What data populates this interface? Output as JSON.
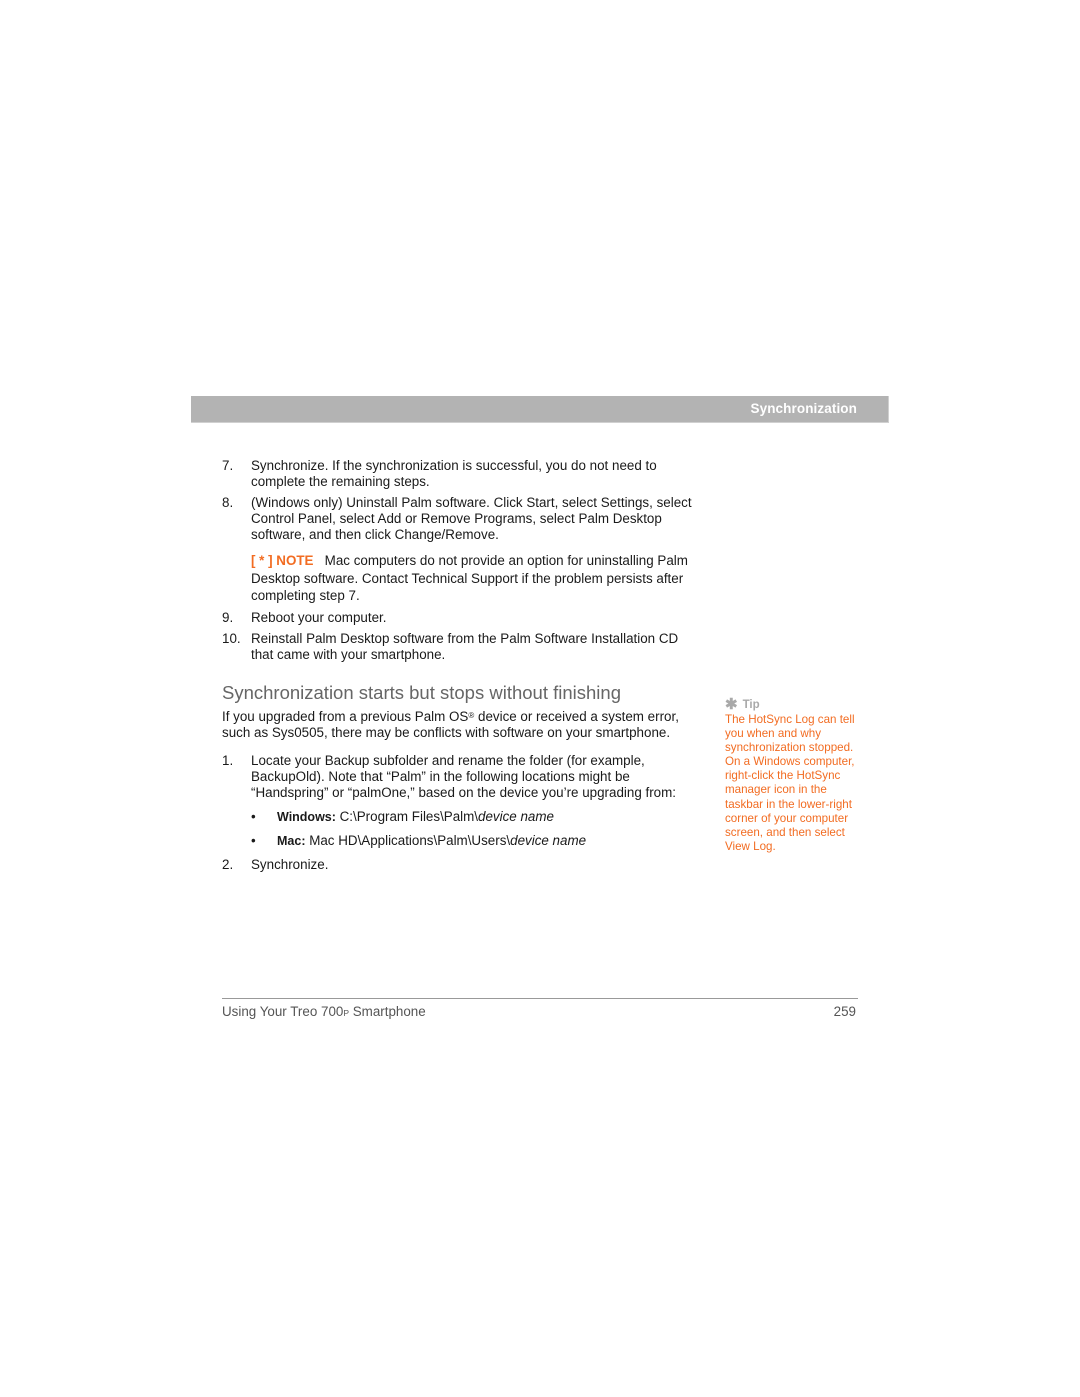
{
  "header": {
    "section_title": "Synchronization"
  },
  "steps_a": [
    {
      "num": "7.",
      "text": "Synchronize. If the synchronization is successful, you do not need to complete the remaining steps."
    },
    {
      "num": "8.",
      "text": "(Windows only) Uninstall Palm software. Click Start, select Settings, select Control Panel, select Add or Remove Programs, select Palm Desktop software, and then click Change/Remove."
    }
  ],
  "note": {
    "tag": "[ * ]  NOTE",
    "text": "Mac computers do not provide an option for uninstalling Palm Desktop software. Contact Technical Support if the problem persists after completing step 7."
  },
  "steps_b": [
    {
      "num": "9.",
      "text": "Reboot your computer."
    },
    {
      "num": "10.",
      "text": "Reinstall Palm Desktop software from the Palm Software Installation CD that came with your smartphone."
    }
  ],
  "section": {
    "title": "Synchronization starts but stops without finishing",
    "intro_before": "If you upgraded from a previous Palm OS",
    "intro_sup": "®",
    "intro_after": " device or received a system error, such as Sys0505, there may be conflicts with software on your smartphone."
  },
  "steps_c": [
    {
      "num": "1.",
      "text": "Locate your Backup subfolder and rename the folder (for example, BackupOld). Note that “Palm” in the following locations might be “Handspring” or “palmOne,” based on the device you’re upgrading from:"
    }
  ],
  "bullets": [
    {
      "label": "Windows:",
      "path": " C:\\Program Files\\Palm\\",
      "italic": "device name"
    },
    {
      "label": "Mac:",
      "path": " Mac HD\\Applications\\Palm\\Users\\",
      "italic": "device name"
    }
  ],
  "steps_d": [
    {
      "num": "2.",
      "text": "Synchronize."
    }
  ],
  "tip": {
    "icon": "asterisk-icon",
    "label": "Tip",
    "text": "The HotSync Log can tell you when and why synchronization stopped. On a Windows computer, right-click the HotSync manager icon in the taskbar in the lower-right corner of your computer screen, and then select View Log."
  },
  "footer": {
    "title_before": "Using Your Treo 700",
    "title_small": "P",
    "title_after": " Smartphone",
    "page_number": "259"
  },
  "colors": {
    "accent": "#f26c22",
    "header_bar": "#b3b3b3",
    "heading_gray": "#666666"
  }
}
